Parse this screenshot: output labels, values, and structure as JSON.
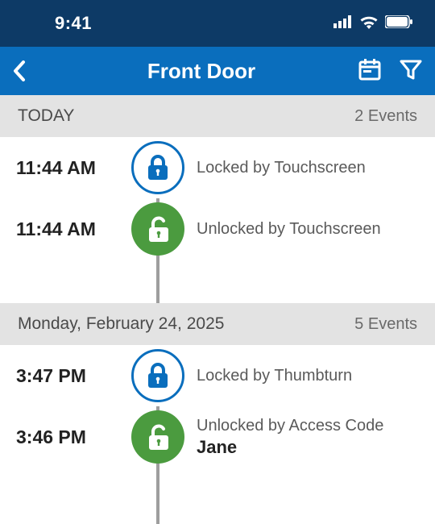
{
  "status": {
    "time": "9:41"
  },
  "nav": {
    "title": "Front Door"
  },
  "sections": [
    {
      "label": "TODAY",
      "count": "2 Events",
      "events": [
        {
          "time": "11:44 AM",
          "state": "locked",
          "desc": "Locked by Touchscreen",
          "sub": ""
        },
        {
          "time": "11:44 AM",
          "state": "unlocked",
          "desc": "Unlocked by Touchscreen",
          "sub": ""
        }
      ]
    },
    {
      "label": "Monday, February 24, 2025",
      "count": "5 Events",
      "events": [
        {
          "time": "3:47 PM",
          "state": "locked",
          "desc": "Locked by Thumbturn",
          "sub": ""
        },
        {
          "time": "3:46 PM",
          "state": "unlocked",
          "desc": "Unlocked by Access Code",
          "sub": "Jane"
        }
      ]
    }
  ]
}
